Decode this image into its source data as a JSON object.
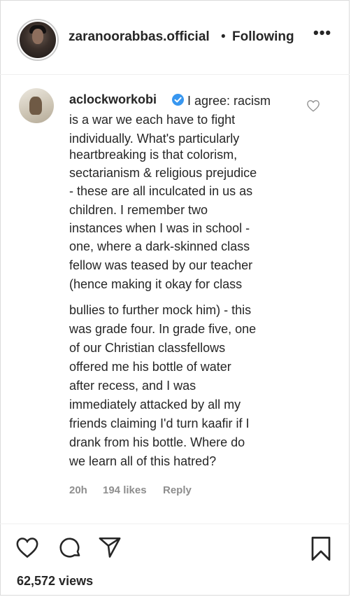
{
  "header": {
    "username": "zaranoorabbas.official",
    "separator": "•",
    "follow_status": "Following",
    "more": "•••"
  },
  "comment": {
    "username": "aclockworkobi",
    "lines": [
      "I agree: racism",
      "is a war we each have to fight",
      "individually. What's particularly",
      "heartbreaking is that colorism,",
      "sectarianism & religious prejudice",
      "- these are all inculcated in us as",
      "children. I remember two",
      "instances when I was in school -",
      "one, where a dark-skinned class",
      "fellow was teased by our teacher",
      "(hence making it okay for class",
      "bullies to further mock him) - this",
      "was grade four. In grade five, one",
      "of our Christian classfellows",
      "offered me his bottle of water",
      "after recess, and I was",
      "immediately attacked by all my",
      "friends claiming I'd turn kaafir if I",
      "drank from his bottle. Where do",
      "we learn all of this hatred?"
    ],
    "time": "20h",
    "likes": "194 likes",
    "reply": "Reply"
  },
  "footer": {
    "views": "62,572 views"
  },
  "icons": {
    "like": "heart-icon",
    "comment": "comment-icon",
    "share": "share-icon",
    "save": "bookmark-icon",
    "verified": "verified-badge-icon",
    "comment_like": "heart-icon"
  },
  "colors": {
    "verified_badge": "#3897f0",
    "meta_text": "#8e8e8e",
    "text": "#262626"
  }
}
